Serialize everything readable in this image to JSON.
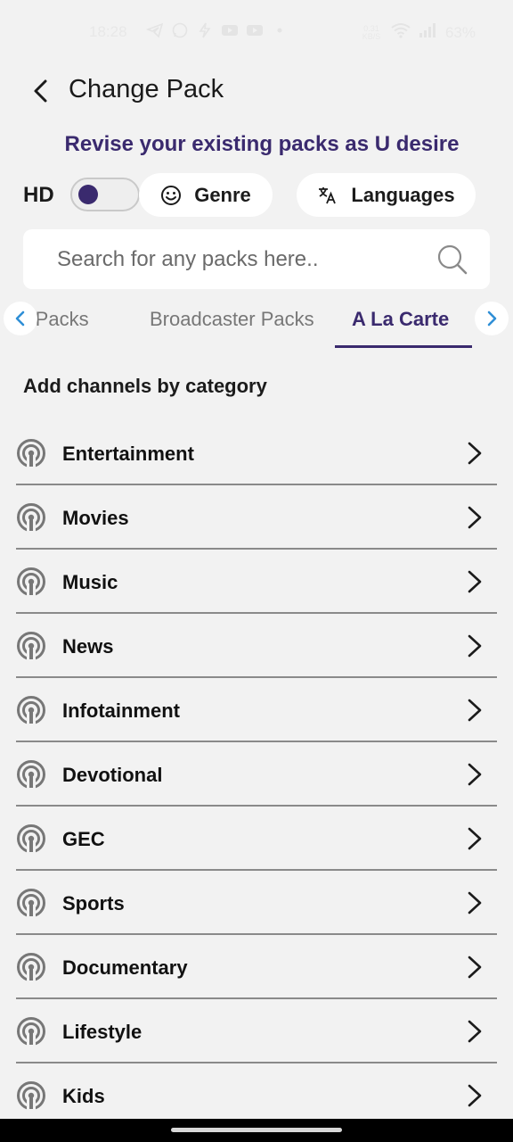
{
  "status_bar": {
    "time": "18:28",
    "net_speed_value": "0.31",
    "net_speed_unit": "KB/S",
    "battery": "63%"
  },
  "header": {
    "title": "Change Pack"
  },
  "subtitle": "Revise your existing packs as U desire",
  "filters": {
    "hd_label": "HD",
    "hd_enabled": false,
    "genre_label": "Genre",
    "languages_label": "Languages"
  },
  "search": {
    "placeholder": "Search for any packs here.."
  },
  "tabs": [
    {
      "label": "ro Packs",
      "active": false
    },
    {
      "label": "Broadcaster Packs",
      "active": false
    },
    {
      "label": "A La Carte",
      "active": true
    }
  ],
  "section_title": "Add channels by category",
  "categories": [
    {
      "label": "Entertainment"
    },
    {
      "label": "Movies"
    },
    {
      "label": "Music"
    },
    {
      "label": "News"
    },
    {
      "label": "Infotainment"
    },
    {
      "label": "Devotional"
    },
    {
      "label": "GEC"
    },
    {
      "label": "Sports"
    },
    {
      "label": "Documentary"
    },
    {
      "label": "Lifestyle"
    },
    {
      "label": "Kids"
    }
  ],
  "colors": {
    "accent": "#3a2a6e",
    "background": "#f2f2f2",
    "arrow_blue": "#2f8fd6"
  }
}
